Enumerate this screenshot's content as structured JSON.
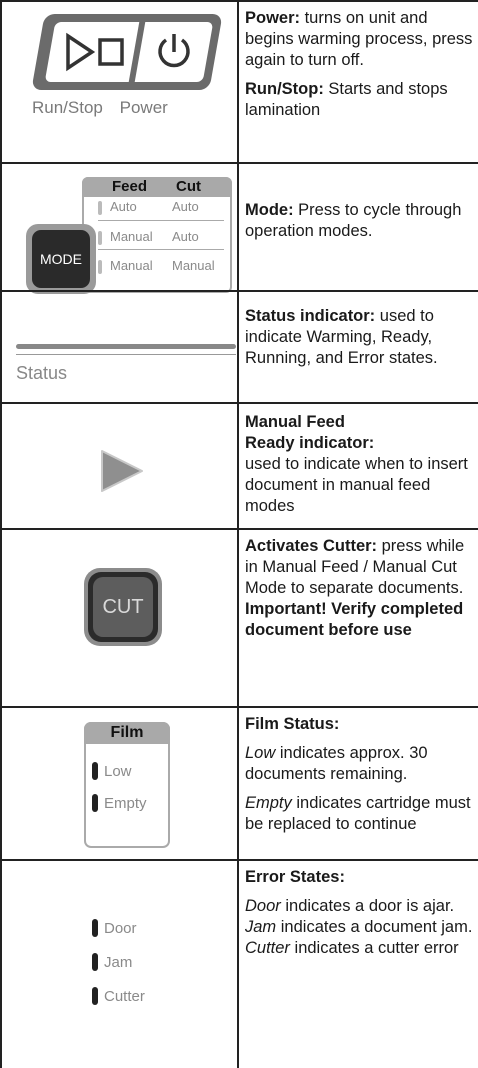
{
  "row1": {
    "caption_run": "Run/Stop",
    "caption_power": "Power",
    "power_title": "Power:",
    "power_text": " turns on unit and begins warming process, press again to turn off.",
    "runstop_title": "Run/Stop:",
    "runstop_text": " Starts and stops lamination"
  },
  "row2": {
    "mode_label": "MODE",
    "head_feed": "Feed",
    "head_cut": "Cut",
    "rows": [
      {
        "feed": "Auto",
        "cut": "Auto"
      },
      {
        "feed": "Manual",
        "cut": "Auto"
      },
      {
        "feed": "Manual",
        "cut": "Manual"
      }
    ],
    "title": "Mode:",
    "text": " Press to cycle through operation modes."
  },
  "row3": {
    "label": "Status",
    "title": "Status indicator:",
    "text": " used to indicate Warming, Ready, Running, and Error states."
  },
  "row4": {
    "title1": "Manual Feed",
    "title2": "Ready indicator:",
    "text": "used to indicate when to insert document in manual feed modes"
  },
  "row5": {
    "cut_label": "CUT",
    "title": "Activates Cutter:",
    "text": " press while in Manual Feed / Manual Cut Mode to separate documents.",
    "important": "Important! Verify completed document before use"
  },
  "row6": {
    "film_head": "Film",
    "low": "Low",
    "empty": "Empty",
    "title": "Film Status:",
    "low_em": "Low",
    "low_text": " indicates approx. 30 documents remaining.",
    "empty_em": "Empty",
    "empty_text": " indicates cartridge must be replaced to continue"
  },
  "row7": {
    "door": "Door",
    "jam": "Jam",
    "cutter": "Cutter",
    "title": "Error States:",
    "door_em": "Door",
    "door_text": " indicates a door is ajar.",
    "jam_em": "Jam",
    "jam_text": " indicates a document jam.",
    "cutter_em": "Cutter",
    "cutter_text": " indicates a cutter error"
  }
}
